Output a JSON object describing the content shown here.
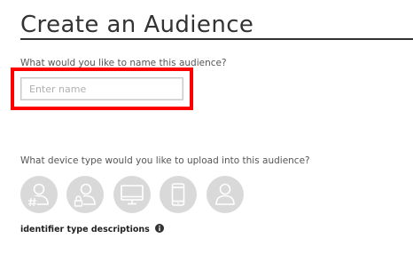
{
  "header": {
    "title": "Create an Audience"
  },
  "name_field": {
    "label": "What would you like to name this audience?",
    "placeholder": "Enter name",
    "value": ""
  },
  "device_section": {
    "label": "What device type would you like to upload into this audience?",
    "options": [
      {
        "icon": "user-hash-icon"
      },
      {
        "icon": "user-lock-icon"
      },
      {
        "icon": "desktop-icon"
      },
      {
        "icon": "mobile-phone-icon"
      },
      {
        "icon": "user-icon"
      }
    ]
  },
  "descriptions": {
    "label": "identifier type descriptions",
    "icon": "info-icon"
  },
  "colors": {
    "highlight": "#ff0000",
    "device_button_bg": "#d9d9d9",
    "device_icon": "#ffffff",
    "title_text": "#333333"
  }
}
